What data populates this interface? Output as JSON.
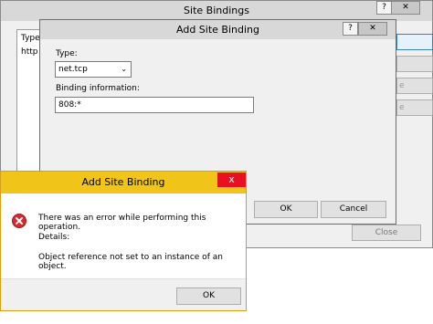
{
  "site_bindings": {
    "title": "Site Bindings",
    "help_button": "?",
    "close_icon": "✕",
    "list_headers": [
      "Type"
    ],
    "list_rows": [
      "http"
    ],
    "right_buttons_partial": [
      "e",
      "e"
    ],
    "close_button_partial": "Close"
  },
  "add_site_binding": {
    "title": "Add Site Binding",
    "help_button": "?",
    "close_icon": "✕",
    "type_label": "Type:",
    "type_value": "net.tcp",
    "binding_label": "Binding information:",
    "binding_value": "808:*",
    "ok_label": "OK",
    "cancel_label": "Cancel"
  },
  "error_dialog": {
    "title": "Add Site Binding",
    "close_icon": "x",
    "message": "There was an error while performing this operation.",
    "details_label": "Details:",
    "details_text": "Object reference not set to an instance of an object.",
    "ok_label": "OK",
    "accent_color": "#e81123",
    "title_bg": "#f0c419"
  }
}
